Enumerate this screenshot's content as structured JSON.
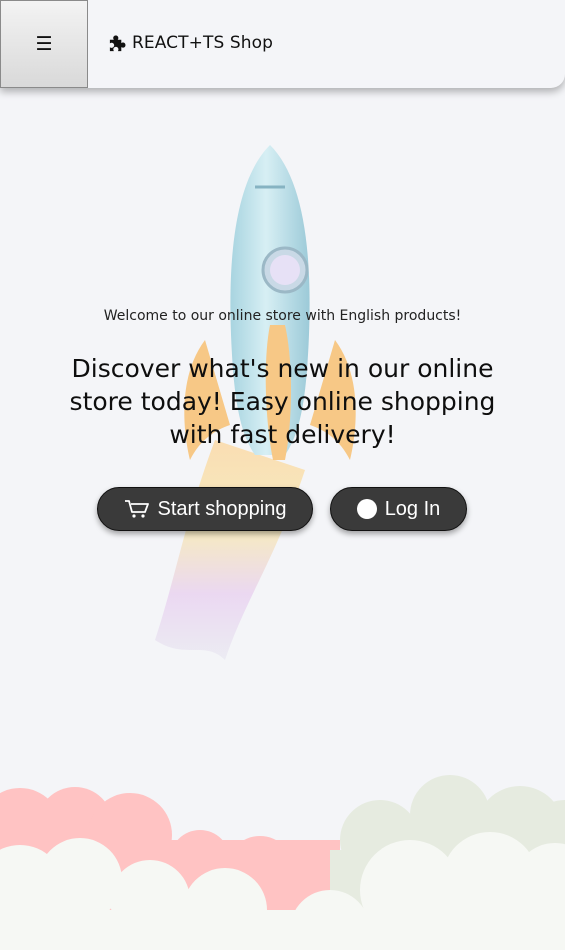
{
  "header": {
    "menu_icon": "☰",
    "brand": "REACT+TS Shop",
    "brand_icon": "puzzle-icon"
  },
  "hero": {
    "welcome": "Welcome to our online store with English products!",
    "headline": "Discover what's new in our online store today! Easy online shopping with fast delivery!",
    "shop_button": "Start shopping",
    "login_button": "Log In"
  },
  "colors": {
    "background": "#f4f5f8",
    "button": "#3a3a3a",
    "button_text": "#ffffff",
    "cloud_pink": "#ffc3c3",
    "cloud_white": "#f6f8f4",
    "cloud_green": "#e6ebe0"
  }
}
